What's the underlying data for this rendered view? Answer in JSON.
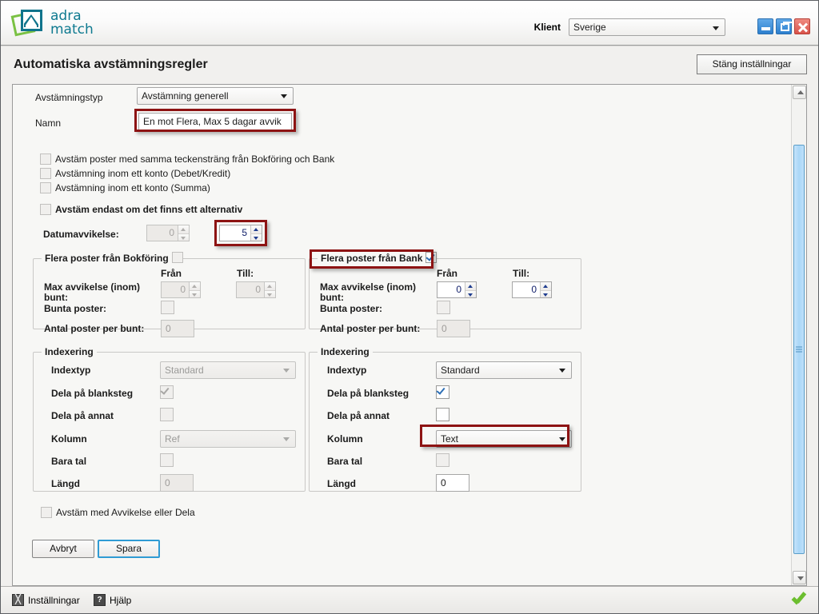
{
  "brand": {
    "line1": "adra",
    "line2": "match",
    "logo_icon": "adra-match-logo",
    "teal": "#10748c",
    "green": "#7ac143"
  },
  "titlebar": {
    "klient_label": "Klient",
    "klient_value": "Sverige",
    "minimize_icon": "minimize-icon",
    "restore_icon": "restore-icon",
    "close_icon": "close-icon"
  },
  "header": {
    "title": "Automatiska avstämningsregler",
    "close_settings_label": "Stäng inställningar"
  },
  "form": {
    "avstamningstyp_label": "Avstämningstyp",
    "avstamningstyp_value": "Avstämning generell",
    "namn_label": "Namn",
    "namn_value": "En mot Flera, Max 5 dagar avvik",
    "checkboxes": [
      {
        "label": "Avstäm poster med samma teckensträng från Bokföring och Bank",
        "checked": false,
        "bold": false
      },
      {
        "label": "Avstämning inom ett konto (Debet/Kredit)",
        "checked": false,
        "bold": false
      },
      {
        "label": "Avstämning inom ett konto (Summa)",
        "checked": false,
        "bold": false
      },
      {
        "label": "Avstäm endast om det finns ett alternativ",
        "checked": false,
        "bold": true
      }
    ],
    "datumavvikelse_label": "Datumavvikelse:",
    "datumavvikelse_from": "0",
    "datumavvikelse_to": "5",
    "avstam_avvikelse_label": "Avstäm med Avvikelse eller Dela",
    "avstam_avvikelse_checked": false,
    "cancel_label": "Avbryt",
    "save_label": "Spara"
  },
  "flera_bokforing": {
    "title": "Flera poster från Bokföring",
    "enabled": false,
    "col_from": "Från",
    "col_to": "Till:",
    "max_avvikelse_label": "Max avvikelse (inom) bunt:",
    "max_avvikelse_from": "0",
    "max_avvikelse_to": "0",
    "bunta_poster_label": "Bunta poster:",
    "bunta_poster_checked": false,
    "antal_poster_label": "Antal poster per bunt:",
    "antal_poster_value": "0"
  },
  "flera_bank": {
    "title": "Flera poster från Bank",
    "enabled": true,
    "col_from": "Från",
    "col_to": "Till:",
    "max_avvikelse_label": "Max avvikelse (inom) bunt:",
    "max_avvikelse_from": "0",
    "max_avvikelse_to": "0",
    "bunta_poster_label": "Bunta poster:",
    "bunta_poster_checked": false,
    "antal_poster_label": "Antal poster per bunt:",
    "antal_poster_value": "0"
  },
  "index_left": {
    "title": "Indexering",
    "indextyp_label": "Indextyp",
    "indextyp_value": "Standard",
    "dela_blanksteg_label": "Dela på blanksteg",
    "dela_blanksteg_checked": true,
    "dela_annat_label": "Dela på annat",
    "dela_annat_checked": false,
    "kolumn_label": "Kolumn",
    "kolumn_value": "Ref",
    "bara_tal_label": "Bara tal",
    "bara_tal_checked": false,
    "langd_label": "Längd",
    "langd_value": "0"
  },
  "index_right": {
    "title": "Indexering",
    "indextyp_label": "Indextyp",
    "indextyp_value": "Standard",
    "dela_blanksteg_label": "Dela på blanksteg",
    "dela_blanksteg_checked": true,
    "dela_annat_label": "Dela på annat",
    "dela_annat_checked": false,
    "kolumn_label": "Kolumn",
    "kolumn_value": "Text",
    "bara_tal_label": "Bara tal",
    "bara_tal_checked": false,
    "langd_label": "Längd",
    "langd_value": "0"
  },
  "statusbar": {
    "settings_label": "Inställningar",
    "settings_icon": "tools-icon",
    "help_label": "Hjälp",
    "help_icon": "question-icon",
    "ok_icon": "green-check-icon"
  },
  "highlight_color": "#8d1313"
}
